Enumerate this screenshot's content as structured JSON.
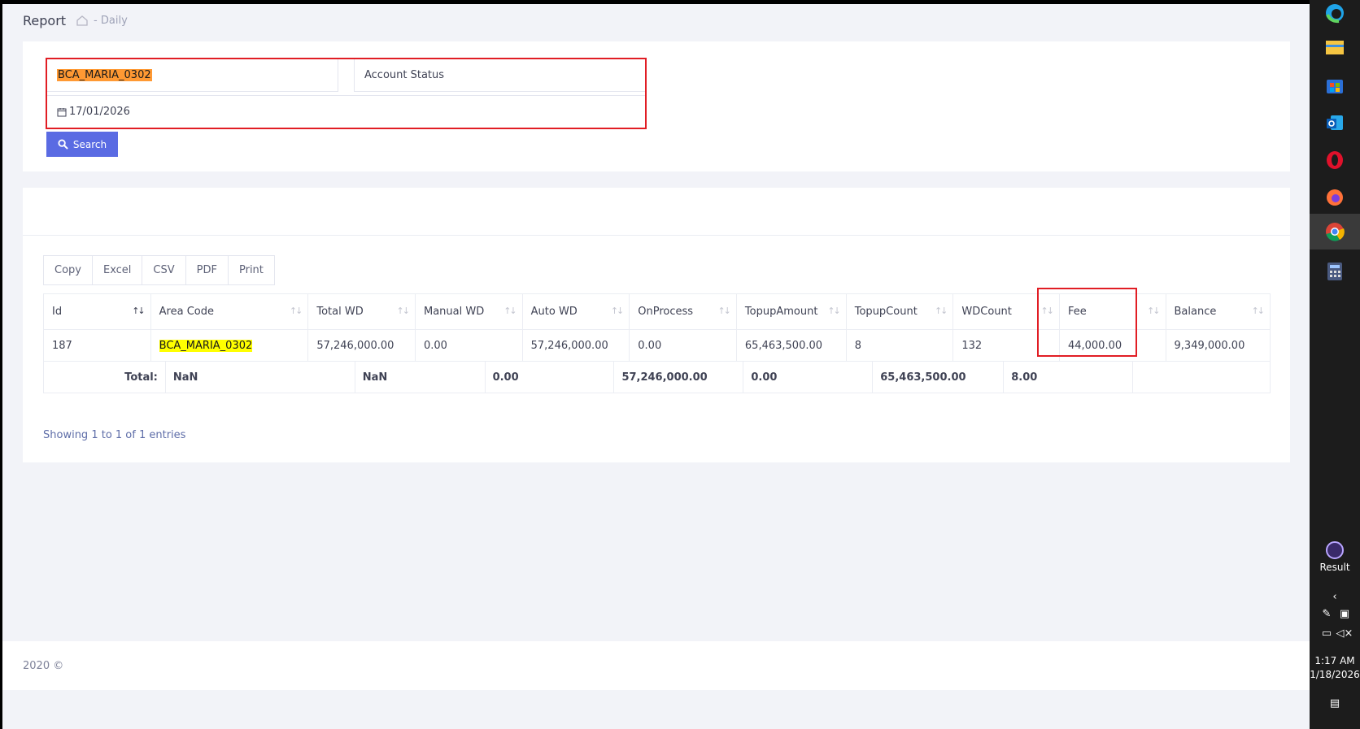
{
  "header": {
    "title": "Report",
    "breadcrumb": "- Daily"
  },
  "filters": {
    "area_code": "BCA_MARIA_0302",
    "account_status_placeholder": "Account Status",
    "date": "17/01/2026",
    "search_label": "Search"
  },
  "export_buttons": [
    "Copy",
    "Excel",
    "CSV",
    "PDF",
    "Print"
  ],
  "table": {
    "columns": [
      "Id",
      "Area Code",
      "Total WD",
      "Manual WD",
      "Auto WD",
      "OnProcess",
      "TopupAmount",
      "TopupCount",
      "WDCount",
      "Fee",
      "Balance"
    ],
    "rows": [
      [
        "187",
        "BCA_MARIA_0302",
        "57,246,000.00",
        "0.00",
        "57,246,000.00",
        "0.00",
        "65,463,500.00",
        "8",
        "132",
        "44,000.00",
        "9,349,000.00"
      ]
    ],
    "totals": {
      "label": "Total:",
      "values": [
        "NaN",
        "NaN",
        "0.00",
        "57,246,000.00",
        "0.00",
        "65,463,500.00",
        "8.00",
        ""
      ]
    },
    "info": "Showing 1 to 1 of 1 entries"
  },
  "footer": {
    "text": "2020 ©"
  },
  "taskbar": {
    "result_label": "Result",
    "time": "1:17 AM",
    "date": "1/18/2026",
    "icons": [
      "edge-icon",
      "file-explorer-icon",
      "store-icon",
      "outlook-icon",
      "opera-icon",
      "firefox-icon",
      "chrome-icon",
      "calculator-icon"
    ]
  },
  "colors": {
    "accent": "#5a6be3",
    "highlight_red": "#e11d24",
    "highlight_orange": "#ff9933",
    "highlight_yellow": "#ffff00"
  }
}
